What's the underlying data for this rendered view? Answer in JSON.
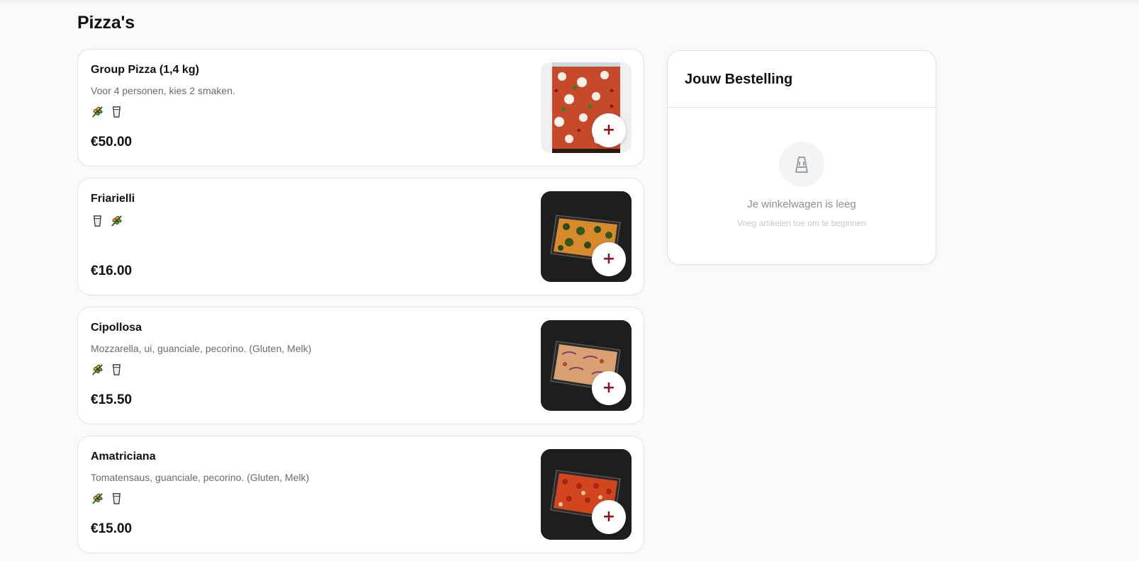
{
  "section": {
    "title": "Pizza's"
  },
  "products": [
    {
      "name": "Group Pizza (1,4 kg)",
      "description": "Voor 4 personen, kies 2 smaken.",
      "badges": [
        "gluten-icon",
        "milk-icon"
      ],
      "price": "€50.00",
      "add_label": "+",
      "image": "group-pizza-image"
    },
    {
      "name": "Friarielli",
      "description": "",
      "badges": [
        "milk-icon",
        "gluten-icon"
      ],
      "price": "€16.00",
      "add_label": "+",
      "image": "friarielli-image"
    },
    {
      "name": "Cipollosa",
      "description": "Mozzarella, ui, guanciale, pecorino. (Gluten, Melk)",
      "badges": [
        "gluten-icon",
        "milk-icon"
      ],
      "price": "€15.50",
      "add_label": "+",
      "image": "cipollosa-image"
    },
    {
      "name": "Amatriciana",
      "description": "Tomatensaus, guanciale, pecorino. (Gluten, Melk)",
      "badges": [
        "gluten-icon",
        "milk-icon"
      ],
      "price": "€15.00",
      "add_label": "+",
      "image": "amatriciana-image"
    }
  ],
  "order": {
    "title": "Jouw Bestelling",
    "empty_title": "Je winkelwagen is leeg",
    "empty_subtitle": "Voeg artikelen toe om te beginnen",
    "empty_icon": "shopping-bag-icon"
  },
  "colors": {
    "accent": "#8b1420",
    "background": "#f9f9f9",
    "muted_text": "#6b6b6b"
  }
}
